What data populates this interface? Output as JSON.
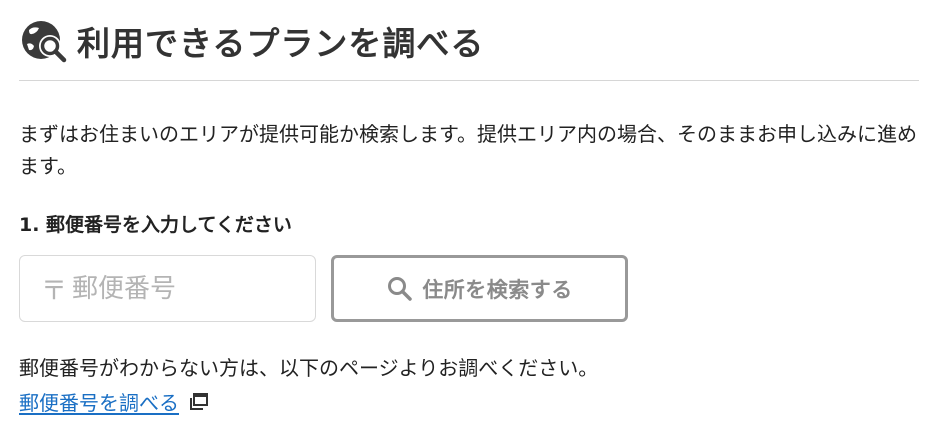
{
  "header": {
    "icon": "map-search-icon",
    "title": "利用できるプランを調べる"
  },
  "intro": {
    "text": "まずはお住まいのエリアが提供可能か検索します。提供エリア内の場合、そのままお申し込みに進めます。"
  },
  "step1": {
    "label": "1. 郵便番号を入力してください"
  },
  "zip_field": {
    "prefix": "〒",
    "placeholder": "郵便番号",
    "value": ""
  },
  "search_button": {
    "icon": "search-icon",
    "label": "住所を検索する"
  },
  "help": {
    "text": "郵便番号がわからない方は、以下のページよりお調べください。",
    "link_label": "郵便番号を調べる",
    "link_icon": "external-window-icon"
  },
  "colors": {
    "link": "#1a6fc4",
    "icon_dark": "#3a3a3a",
    "button_border": "#999999",
    "button_text": "#8a8a8a",
    "placeholder": "#b4b4b4",
    "divider": "#d6d6d6"
  }
}
